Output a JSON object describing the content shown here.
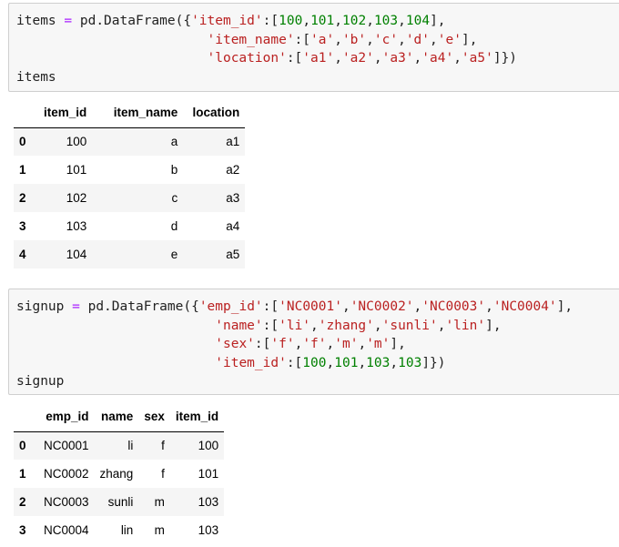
{
  "cell1": {
    "line1": {
      "prefix": "items",
      "eq": "=",
      "call": "pd.DataFrame({",
      "key": "'item_id'",
      "sep": ":[",
      "nums": [
        "100",
        "101",
        "102",
        "103",
        "104"
      ],
      "end": "],"
    },
    "line2": {
      "key": "'item_name'",
      "sep": ":[",
      "strs": [
        "'a'",
        "'b'",
        "'c'",
        "'d'",
        "'e'"
      ],
      "end": "],"
    },
    "line3": {
      "key": "'location'",
      "sep": ":[",
      "strs": [
        "'a1'",
        "'a2'",
        "'a3'",
        "'a4'",
        "'a5'"
      ],
      "end": "]})"
    },
    "line4": "items"
  },
  "table1": {
    "headers": [
      "",
      "item_id",
      "item_name",
      "location"
    ],
    "rows": [
      [
        "0",
        "100",
        "a",
        "a1"
      ],
      [
        "1",
        "101",
        "b",
        "a2"
      ],
      [
        "2",
        "102",
        "c",
        "a3"
      ],
      [
        "3",
        "103",
        "d",
        "a4"
      ],
      [
        "4",
        "104",
        "e",
        "a5"
      ]
    ]
  },
  "cell2": {
    "line1": {
      "prefix": "signup",
      "eq": "=",
      "call": "pd.DataFrame({",
      "key": "'emp_id'",
      "sep": ":[",
      "strs": [
        "'NC0001'",
        "'NC0002'",
        "'NC0003'",
        "'NC0004'"
      ],
      "end": "],"
    },
    "line2": {
      "key": "'name'",
      "sep": ":[",
      "strs": [
        "'li'",
        "'zhang'",
        "'sunli'",
        "'lin'"
      ],
      "end": "],"
    },
    "line3": {
      "key": "'sex'",
      "sep": ":[",
      "strs": [
        "'f'",
        "'f'",
        "'m'",
        "'m'"
      ],
      "end": "],"
    },
    "line4": {
      "key": "'item_id'",
      "sep": ":[",
      "nums": [
        "100",
        "101",
        "103",
        "103"
      ],
      "end": "]})"
    },
    "line5": "signup"
  },
  "table2": {
    "headers": [
      "",
      "emp_id",
      "name",
      "sex",
      "item_id"
    ],
    "rows": [
      [
        "0",
        "NC0001",
        "li",
        "f",
        "100"
      ],
      [
        "1",
        "NC0002",
        "zhang",
        "f",
        "101"
      ],
      [
        "2",
        "NC0003",
        "sunli",
        "m",
        "103"
      ],
      [
        "3",
        "NC0004",
        "lin",
        "m",
        "103"
      ]
    ]
  }
}
